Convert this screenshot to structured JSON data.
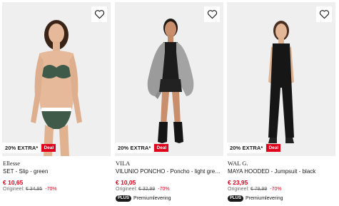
{
  "products": [
    {
      "brand": "Ellesse",
      "title": "SET - Slip - green",
      "price": "€ 10,65",
      "original_label": "Origineel:",
      "original_price": "€ 34,95",
      "discount": "-70%",
      "extra_badge": "20% EXTRA*",
      "deal_badge": "Deal",
      "plus": null,
      "wishlist_icon": "heart-outline-icon"
    },
    {
      "brand": "VILA",
      "title": "VILUNIO PONCHO - Poncho - light grey melange",
      "price": "€ 10,05",
      "original_label": "Origineel:",
      "original_price": "€ 32,99",
      "discount": "-70%",
      "extra_badge": "20% EXTRA*",
      "deal_badge": "Deal",
      "plus": {
        "badge": "PLUS",
        "text": "Premiumlevering"
      },
      "wishlist_icon": "heart-outline-icon"
    },
    {
      "brand": "WAL G.",
      "title": "MAYA HOODED - Jumpsuit - black",
      "price": "€ 23,95",
      "original_label": "Origineel:",
      "original_price": "€ 79,99",
      "discount": "-70%",
      "extra_badge": "20% EXTRA*",
      "deal_badge": "Deal",
      "plus": {
        "badge": "PLUS",
        "text": "Premiumlevering"
      },
      "wishlist_icon": "heart-outline-icon"
    }
  ],
  "colors": {
    "deal_red": "#e0001b",
    "price_red": "#e0001b",
    "image_bg": "#efefef",
    "text": "#1a1a1a",
    "muted": "#6b6b6b"
  }
}
